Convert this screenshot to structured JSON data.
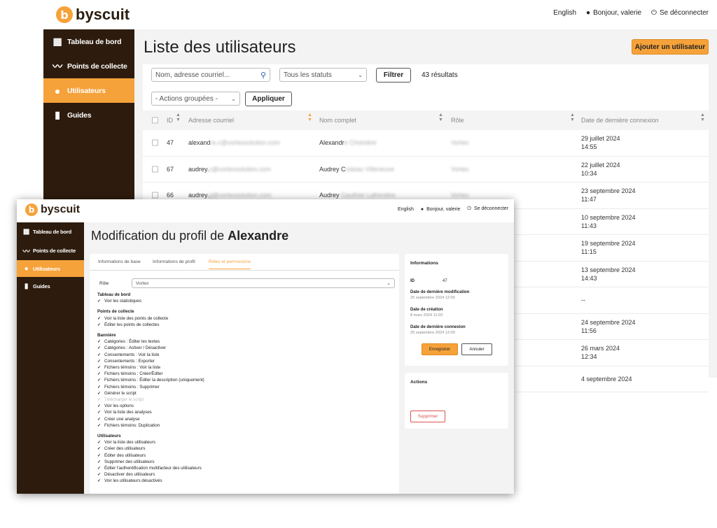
{
  "brand": {
    "name": "byscuit",
    "mark": "b"
  },
  "topnav": {
    "language": "English",
    "greeting": "Bonjour, valerie",
    "logout": "Se déconnecter"
  },
  "sidebar": {
    "items": [
      {
        "label": "Tableau de bord",
        "icon": "dashboard-grid-icon"
      },
      {
        "label": "Points de collecte",
        "icon": "signature-icon"
      },
      {
        "label": "Utilisateurs",
        "icon": "user-icon",
        "active": true
      },
      {
        "label": "Guides",
        "icon": "book-icon"
      }
    ]
  },
  "users_page": {
    "title": "Liste des utilisateurs",
    "add_button": "Ajouter un utilisateur",
    "search_placeholder": "Nom, adresse courriel...",
    "status_select": "Tous les statuts",
    "filter_button": "Filtrer",
    "results": "43 résultats",
    "bulk_select": "- Actions groupées -",
    "apply_button": "Appliquer",
    "columns": [
      "ID",
      "Adresse courriel",
      "Nom complet",
      "Rôle",
      "Date de dernière connexion"
    ],
    "rows": [
      {
        "id": "47",
        "email_visible": "alexand",
        "email_blur": "re.c@vortexsolution.com",
        "name_visible": "Alexandr",
        "name_blur": "e Choinière",
        "role": "Vortex",
        "date": "29 juillet 2024",
        "time": "14:55"
      },
      {
        "id": "67",
        "email_visible": "audrey.",
        "email_blur": "c@vortexsolution.com",
        "name_visible": "Audrey C",
        "name_blur": "roteau Villeneuve",
        "role": "Vortex",
        "date": "22 juillet 2024",
        "time": "10:34"
      },
      {
        "id": "66",
        "email_visible": "audrey.",
        "email_blur": "g@vortexsolution.com",
        "name_visible": "Audrey ",
        "name_blur": "Gauthier Lafrenière",
        "role": "Vortex",
        "date": "23 septembre 2024",
        "time": "11:47"
      },
      {
        "id": "",
        "email_visible": "",
        "email_blur": "",
        "name_visible": "",
        "name_blur": "",
        "role": "",
        "date": "10 septembre 2024",
        "time": "11:43"
      },
      {
        "id": "",
        "email_visible": "",
        "email_blur": "",
        "name_visible": "",
        "name_blur": "",
        "role": "",
        "date": "19 septembre 2024",
        "time": "11:15"
      },
      {
        "id": "",
        "email_visible": "",
        "email_blur": "",
        "name_visible": "",
        "name_blur": "",
        "role": "",
        "date": "13 septembre 2024",
        "time": "14:43"
      },
      {
        "id": "",
        "email_visible": "",
        "email_blur": "",
        "name_visible": "",
        "name_blur": "",
        "role": "",
        "date": "--",
        "time": ""
      },
      {
        "id": "",
        "email_visible": "",
        "email_blur": "",
        "name_visible": "",
        "name_blur": "",
        "role": "",
        "date": "24 septembre 2024",
        "time": "11:56"
      },
      {
        "id": "",
        "email_visible": "",
        "email_blur": "",
        "name_visible": "",
        "name_blur": "",
        "role": "",
        "date": "26 mars 2024",
        "time": "12:34"
      },
      {
        "id": "",
        "email_visible": "",
        "email_blur": "",
        "name_visible": "",
        "name_blur": "",
        "role": "",
        "date": "4 septembre 2024",
        "time": ""
      }
    ]
  },
  "profile_page": {
    "title_prefix": "Modification du profil de ",
    "title_name": "Alexandre",
    "tabs": [
      "Informations de base",
      "Informations de profil",
      "Rôles et permissions"
    ],
    "role_label": "Rôle",
    "role_value": "Vortex",
    "permissions": [
      {
        "heading": "Tableau de bord",
        "items": [
          {
            "t": "Voir les statistiques"
          }
        ]
      },
      {
        "heading": "Points de collecte",
        "items": [
          {
            "t": "Voir la liste des points de collecte"
          },
          {
            "t": "Éditer les points de collectes"
          }
        ]
      },
      {
        "heading": "Bannière",
        "items": [
          {
            "t": "Catégories : Éditer les textes"
          },
          {
            "t": "Catégories : Activer / Désactiver"
          },
          {
            "t": "Consentements : Voir la liste"
          },
          {
            "t": "Consentements : Exporter"
          },
          {
            "t": "Fichiers témoins : Voir la liste"
          },
          {
            "t": "Fichiers témoins : Créer/Éditer"
          },
          {
            "t": "Fichiers témoins : Éditer la description (uniquement)"
          },
          {
            "t": "Fichiers témoins : Supprimer"
          },
          {
            "t": "Générer le script"
          },
          {
            "t": "Télécharger le script",
            "disabled": true
          },
          {
            "t": "Voir les options"
          },
          {
            "t": "Voir la liste des analyses"
          },
          {
            "t": "Créer une analyse"
          },
          {
            "t": "Fichiers témoins: Duplication"
          }
        ]
      },
      {
        "heading": "Utilisateurs",
        "items": [
          {
            "t": "Voir la liste des utilisateurs"
          },
          {
            "t": "Créer des utilisateurs"
          },
          {
            "t": "Éditer des utilisateurs"
          },
          {
            "t": "Supprimer des utilisateurs"
          },
          {
            "t": "Éditer l'authentification multifacteur des utilisateurs"
          },
          {
            "t": "Désactiver des utilisateurs"
          },
          {
            "t": "Voir les utilisateurs désactivés"
          }
        ]
      }
    ],
    "info": {
      "title": "Informations",
      "id_label": "ID",
      "id_value": "47",
      "modified_label": "Date de dernière modification",
      "modified_value": "25 septembre 2024 12:09",
      "created_label": "Date de création",
      "created_value": "8 mars 2024 11:03",
      "login_label": "Date de dernière connexion",
      "login_value": "25 septembre 2024 12:09",
      "save_button": "Enregistrer",
      "cancel_button": "Annuler"
    },
    "actions": {
      "title": "Actions",
      "delete_button": "Supprimer"
    }
  },
  "colors": {
    "accent": "#f6a23a",
    "sidebar": "#2d1c0e",
    "danger": "#d9534f"
  }
}
